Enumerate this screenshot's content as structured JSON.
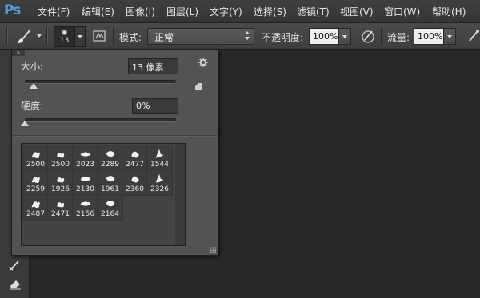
{
  "app": {
    "logo": "Ps"
  },
  "menu": [
    {
      "label": "文件(F)"
    },
    {
      "label": "编辑(E)"
    },
    {
      "label": "图像(I)"
    },
    {
      "label": "图层(L)"
    },
    {
      "label": "文字(Y)"
    },
    {
      "label": "选择(S)"
    },
    {
      "label": "滤镜(T)"
    },
    {
      "label": "视图(V)"
    },
    {
      "label": "窗口(W)"
    },
    {
      "label": "帮助(H)"
    }
  ],
  "options_bar": {
    "tool_icon": "brush-icon",
    "brush_size": "13",
    "mode_label": "模式:",
    "mode_value": "正常",
    "opacity_label": "不透明度:",
    "opacity_value": "100%",
    "flow_label": "流量:",
    "flow_value": "100%"
  },
  "brush_popup": {
    "collapse_glyph": "»",
    "size_label": "大小:",
    "size_value": "13 像素",
    "size_slider": 0.06,
    "hardness_label": "硬度:",
    "hardness_value": "0%",
    "hardness_slider": 0.0,
    "presets": [
      "2500",
      "2500",
      "2023",
      "2289",
      "2477",
      "1544",
      "2259",
      "1926",
      "2130",
      "1961",
      "2360",
      "2326",
      "2487",
      "2471",
      "2156",
      "2164"
    ]
  },
  "colors": {
    "canvas": "#282828",
    "panel": "#535353",
    "logo": "#4fa3e8"
  }
}
